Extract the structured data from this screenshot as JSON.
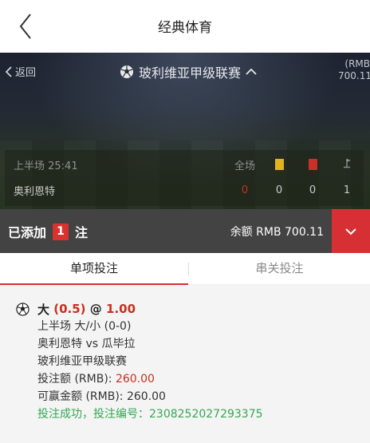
{
  "header": {
    "title": "经典体育"
  },
  "hero": {
    "back_label": "返回",
    "league_title": "玻利维亚甲级联赛",
    "balance_top": "(RMB",
    "balance_bottom": "700.11"
  },
  "scoreboard": {
    "period": "上半场 25:41",
    "full_label": "全场",
    "team": "奥利恩特",
    "score": "0",
    "yellow_cards": "0",
    "red_cards": "0",
    "corners": "1"
  },
  "bet_bar": {
    "added_label": "已添加",
    "count": "1",
    "unit": "注",
    "balance_text": "余额 RMB 700.11"
  },
  "tabs": [
    {
      "label": "单项投注"
    },
    {
      "label": "串关投注"
    }
  ],
  "bet": {
    "selection": "大",
    "handicap": "(0.5)",
    "at": "@",
    "odds": "1.00",
    "market": "上半场 大/小 (0-0)",
    "match": "奥利恩特 vs 瓜毕拉",
    "league": "玻利维亚甲级联赛",
    "stake_label": "投注额 (RMB): ",
    "stake_value": "260.00",
    "win_label": "可赢金额 (RMB): ",
    "win_value": "260.00",
    "status": "投注成功，投注编号：2308252027293375"
  },
  "colors": {
    "accent": "#d63034",
    "success": "#33a853",
    "bar_bg": "#434343"
  }
}
